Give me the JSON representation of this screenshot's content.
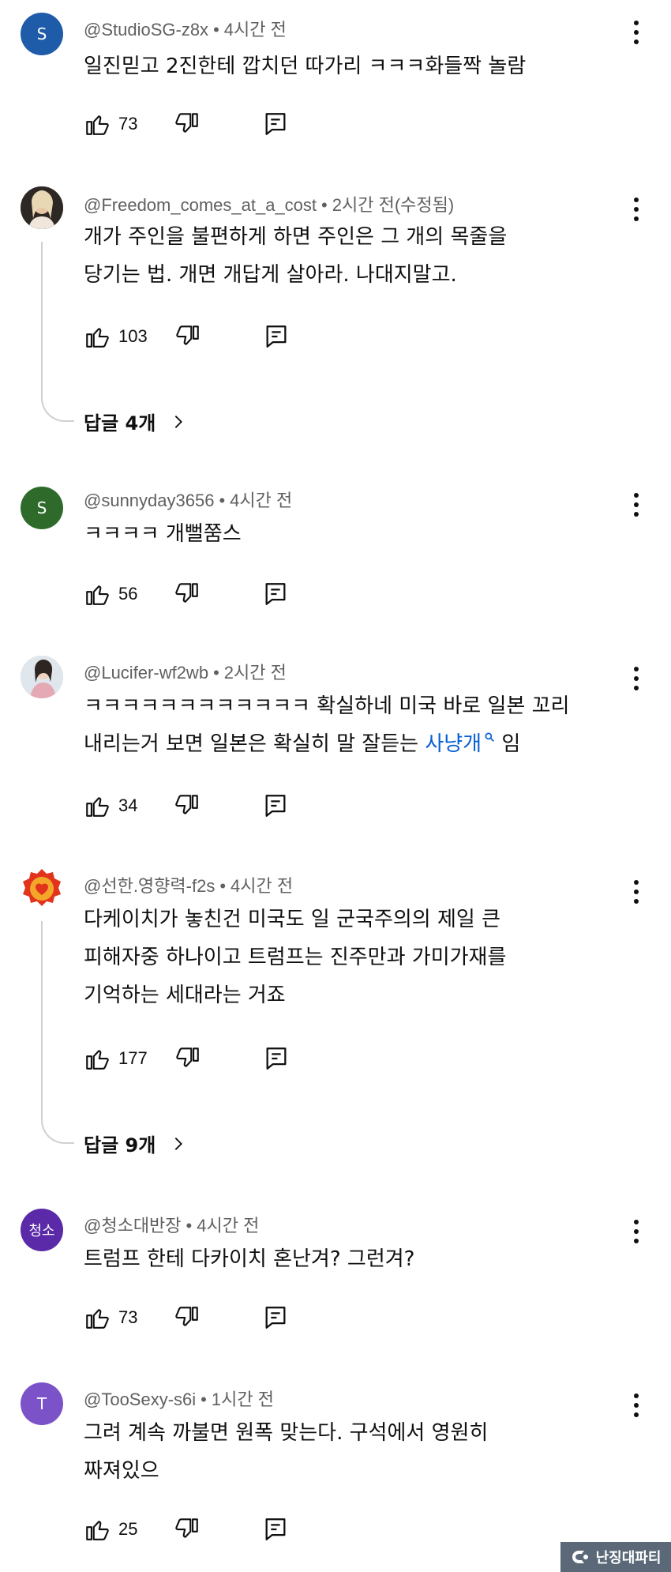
{
  "comments": [
    {
      "author": "@StudioSG-z8x",
      "time": "4시간 전",
      "text": "일진믿고 2진한테 깝치던 따가리 ㅋㅋㅋ화들짝 놀람",
      "likes": "73",
      "avatar_letter": "S",
      "avatar_color": "#1e5ba8"
    },
    {
      "author": "@Freedom_comes_at_a_cost",
      "time": "2시간 전(수정됨)",
      "text": "개가 주인을 불편하게 하면 주인은 그 개의 목줄을\n당기는 법. 개면 개답게 살아라. 나대지말고.",
      "likes": "103",
      "avatar_color": "#3b3530",
      "replies": "답글 4개"
    },
    {
      "author": "@sunnyday3656",
      "time": "4시간 전",
      "text": "ㅋㅋㅋㅋ 개뻘쭘스",
      "likes": "56",
      "avatar_letter": "S",
      "avatar_color": "#2e6b2a"
    },
    {
      "author": "@Lucifer-wf2wb",
      "time": "2시간 전",
      "text_before": "ㅋㅋㅋㅋㅋㅋㅋㅋㅋㅋㅋㅋ 확실하네 미국 바로 일본 꼬리\n내리는거 보면 일본은 확실히 말 잘듣는 ",
      "text_link": "사냥개",
      "text_after": " 임",
      "likes": "34",
      "avatar_color": "#c9d4df"
    },
    {
      "author": "@선한.영향력-f2s",
      "time": "4시간 전",
      "text": "다케이치가 놓친건 미국도 일 군국주의의 제일 큰\n피해자중 하나이고 트럼프는 진주만과 가미가재를\n기억하는 세대라는 거죠",
      "likes": "177",
      "avatar_color": "#e2341c",
      "replies": "답글 9개"
    },
    {
      "author": "@청소대반장",
      "time": "4시간 전",
      "text": "트럼프 한테 다카이치 혼난겨? 그런겨?",
      "likes": "73",
      "avatar_letter": "청소",
      "avatar_color": "#5a2aa8"
    },
    {
      "author": "@TooSexy-s6i",
      "time": "1시간 전",
      "text": "그려 계속 까불면 원폭 맞는다. 구석에서 영원히\n짜져있으",
      "likes": "25",
      "avatar_letter": "T",
      "avatar_color": "#7b52c8"
    }
  ],
  "watermark": "난징대파티",
  "icons": {
    "like": "thumbs-up-icon",
    "dislike": "thumbs-down-icon",
    "reply": "reply-icon",
    "more": "more-vert-icon",
    "search": "search-icon",
    "chevron": "chevron-right-icon"
  }
}
